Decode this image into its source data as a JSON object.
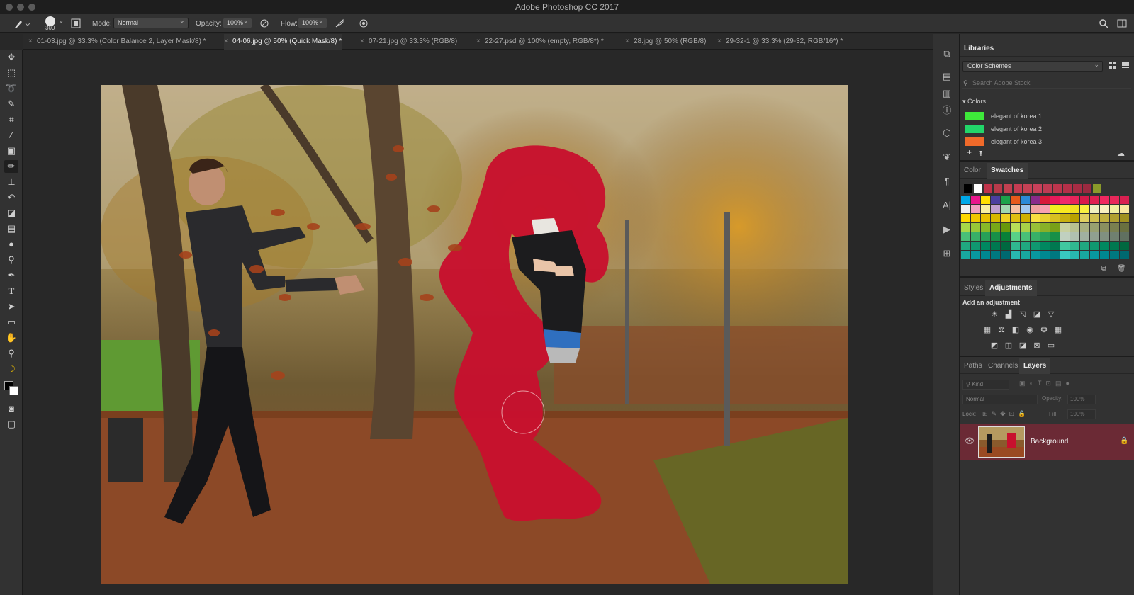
{
  "window": {
    "title": "Adobe Photoshop CC 2017"
  },
  "options_bar": {
    "brush_size": "300",
    "mode_label": "Mode:",
    "mode_value": "Normal",
    "opacity_label": "Opacity:",
    "opacity_value": "100%",
    "flow_label": "Flow:",
    "flow_value": "100%"
  },
  "doc_tabs": [
    {
      "label": "01-03.jpg @ 33.3% (Color Balance 2, Layer Mask/8) *",
      "active": false
    },
    {
      "label": "04-06.jpg @ 50% (Quick Mask/8) *",
      "active": true
    },
    {
      "label": "07-21.jpg @ 33.3% (RGB/8)",
      "active": false
    },
    {
      "label": "22-27.psd @ 100% (empty, RGB/8*) *",
      "active": false
    },
    {
      "label": "28.jpg @ 50% (RGB/8)",
      "active": false
    },
    {
      "label": "29-32-1 @ 33.3% (29-32, RGB/16*) *",
      "active": false
    }
  ],
  "tools": [
    "move-tool",
    "marquee-tool",
    "lasso-tool",
    "quick-select-tool",
    "crop-tool",
    "eyedropper-tool",
    "healing-tool",
    "brush-tool",
    "clone-stamp-tool",
    "history-brush-tool",
    "eraser-tool",
    "gradient-tool",
    "blur-tool",
    "dodge-tool",
    "pen-tool",
    "type-tool",
    "path-select-tool",
    "rectangle-tool",
    "hand-tool",
    "zoom-tool"
  ],
  "libraries": {
    "tab": "Libraries",
    "dropdown": "Color Schemes",
    "search_placeholder": "Search Adobe Stock",
    "section": "Colors",
    "colors": [
      {
        "name": "elegant of korea 1",
        "hex": "#3ee83a"
      },
      {
        "name": "elegant of korea 2",
        "hex": "#22d66a"
      },
      {
        "name": "elegant of korea 3",
        "hex": "#f06a2a"
      }
    ]
  },
  "color_panel": {
    "tabs": [
      "Color",
      "Swatches"
    ],
    "active": "Swatches"
  },
  "adjust_panel": {
    "tabs": [
      "Styles",
      "Adjustments"
    ],
    "active": "Adjustments",
    "heading": "Add an adjustment"
  },
  "layers_panel": {
    "tabs": [
      "Paths",
      "Channels",
      "Layers"
    ],
    "active": "Layers",
    "kind": "Kind",
    "blend": "Normal",
    "opacity_label": "Opacity:",
    "opacity_value": "100%",
    "lock_label": "Lock:",
    "fill_label": "Fill:",
    "fill_value": "100%",
    "layer_name": "Background"
  },
  "colors": {
    "accent_red": "#c8102e",
    "panel_bg": "#323232",
    "layer_highlight": "#6b2a35"
  }
}
